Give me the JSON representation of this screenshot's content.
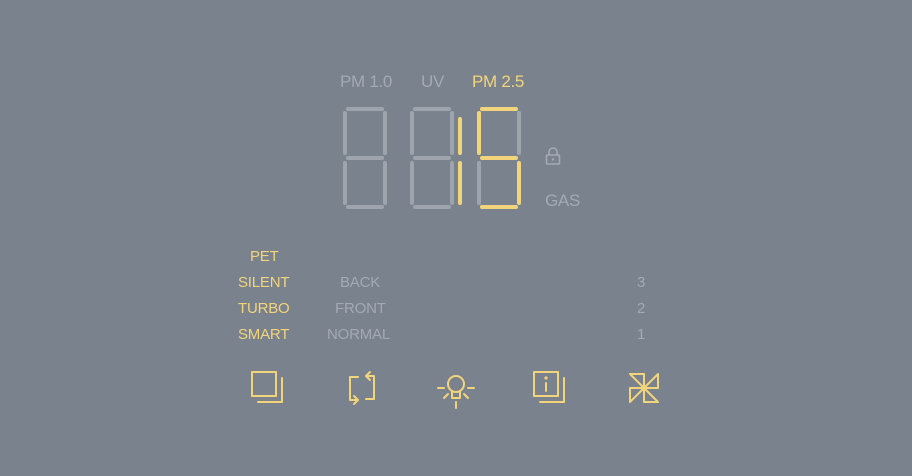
{
  "colors": {
    "background": "#7a828e",
    "active": "#f2d57a",
    "inactive": "#a3aab4"
  },
  "sensors": [
    {
      "label": "PM 1.0",
      "active": false
    },
    {
      "label": "UV",
      "active": false
    },
    {
      "label": "PM 2.5",
      "active": true
    }
  ],
  "display": {
    "digits": [
      "8",
      "8",
      "5"
    ],
    "active_segments": [
      "0,0,0,0,0,0,0",
      "0,0,0,0,0,0,0",
      "1,0,1,1,0,1,1"
    ]
  },
  "lock": {
    "icon": "lock-icon",
    "active": false
  },
  "gas": {
    "label": "GAS",
    "active": false
  },
  "modes": {
    "left": [
      {
        "label": "PET",
        "active": true
      },
      {
        "label": "SILENT",
        "active": true
      },
      {
        "label": "TURBO",
        "active": true
      },
      {
        "label": "SMART",
        "active": true
      }
    ],
    "middle": [
      {
        "label": "BACK",
        "active": false
      },
      {
        "label": "FRONT",
        "active": false
      },
      {
        "label": "NORMAL",
        "active": false
      }
    ],
    "levels": [
      "3",
      "2",
      "1"
    ]
  },
  "controls": [
    {
      "name": "filter-icon",
      "label": "filter"
    },
    {
      "name": "recirculate-icon",
      "label": "recirculate"
    },
    {
      "name": "light-icon",
      "label": "light"
    },
    {
      "name": "info-icon",
      "label": "info"
    },
    {
      "name": "fan-icon",
      "label": "fan"
    }
  ]
}
